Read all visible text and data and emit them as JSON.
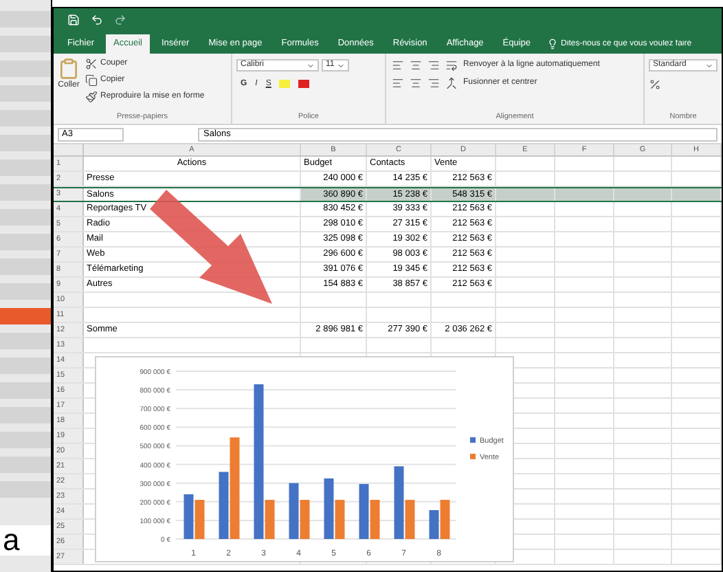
{
  "tabs": [
    {
      "label": "Fichier",
      "selected": false
    },
    {
      "label": "Accueil",
      "selected": true
    },
    {
      "label": "Insérer",
      "selected": false
    },
    {
      "label": "Mise en page",
      "selected": false
    },
    {
      "label": "Formules",
      "selected": false
    },
    {
      "label": "Données",
      "selected": false
    },
    {
      "label": "Révision",
      "selected": false
    },
    {
      "label": "Affichage",
      "selected": false
    },
    {
      "label": "Équipe",
      "selected": false
    }
  ],
  "tell_me": {
    "placeholder": "Dites-nous ce que vous voulez faire"
  },
  "ribbon": {
    "clipboard": {
      "paste": "Coller",
      "cut": "Couper",
      "copy": "Copier",
      "format_painter": "Reproduire la mise en forme",
      "label": "Presse-papiers"
    },
    "font": {
      "family": "Calibri",
      "size": "11",
      "styles": [
        "G",
        "I",
        "S"
      ],
      "label": "Police"
    },
    "alignment": {
      "wrap": "Renvoyer à la ligne automatiquement",
      "merge": "Fusionner et centrer",
      "label": "Alignement"
    },
    "number": {
      "format": "Standard",
      "label": "Nombre"
    }
  },
  "formula_bar": {
    "cell": "A3",
    "value": "Salons"
  },
  "sheet": {
    "columns": [
      "A",
      "B",
      "C",
      "D",
      "E",
      "F",
      "G",
      "H"
    ],
    "rows": [
      {
        "number": "1",
        "cells": [
          "Actions",
          "Budget",
          "Contacts",
          "Vente"
        ],
        "selected": false
      },
      {
        "number": "2",
        "cells": [
          "Presse",
          "240 000 €",
          "14 235 €",
          "212 563 €"
        ],
        "selected": false
      },
      {
        "number": "3",
        "cells": [
          "Salons",
          "360 890 €",
          "15 238 €",
          "548 315 €"
        ],
        "selected": true
      },
      {
        "number": "4",
        "cells": [
          "Reportages TV",
          "830 452 €",
          "39 333 €",
          "212 563 €"
        ],
        "selected": false
      },
      {
        "number": "5",
        "cells": [
          "Radio",
          "298 010 €",
          "27 315 €",
          "212 563 €"
        ],
        "selected": false
      },
      {
        "number": "6",
        "cells": [
          "Mail",
          "325 098 €",
          "19 302 €",
          "212 563 €"
        ],
        "selected": false
      },
      {
        "number": "7",
        "cells": [
          "Web",
          "296 600 €",
          "98 003 €",
          "212 563 €"
        ],
        "selected": false
      },
      {
        "number": "8",
        "cells": [
          "Télémarketing",
          "391 076 €",
          "19 345 €",
          "212 563 €"
        ],
        "selected": false
      },
      {
        "number": "9",
        "cells": [
          "Autres",
          "154 883 €",
          "38 857 €",
          "212 563 €"
        ],
        "selected": false
      },
      {
        "number": "10",
        "selected": false
      },
      {
        "number": "11",
        "selected": false
      },
      {
        "number": "12",
        "cells": [
          "Somme",
          "2 896 981 €",
          "277 390 €",
          "2 036 262 €"
        ],
        "selected": false
      },
      {
        "number": "13",
        "selected": false
      },
      {
        "number": "14",
        "selected": false
      },
      {
        "number": "15",
        "selected": false
      },
      {
        "number": "16",
        "selected": false
      },
      {
        "number": "17",
        "selected": false
      },
      {
        "number": "18",
        "selected": false
      },
      {
        "number": "19",
        "selected": false
      },
      {
        "number": "20",
        "selected": false
      },
      {
        "number": "21",
        "selected": false
      },
      {
        "number": "22",
        "selected": false
      },
      {
        "number": "23",
        "selected": false
      },
      {
        "number": "24",
        "selected": false
      },
      {
        "number": "25",
        "selected": false
      },
      {
        "number": "26",
        "selected": false
      },
      {
        "number": "27",
        "selected": false
      }
    ],
    "chart_data": {
      "type": "bar",
      "categories": [
        "1",
        "2",
        "3",
        "4",
        "5",
        "6",
        "7",
        "8"
      ],
      "series": [
        {
          "name": "Budget",
          "color": "#4472c4",
          "values": [
            240000,
            360000,
            830000,
            300000,
            325000,
            295000,
            390000,
            155000
          ]
        },
        {
          "name": "Vente",
          "color": "#ed7d31",
          "values": [
            210000,
            545000,
            210000,
            210000,
            210000,
            210000,
            210000,
            210000
          ]
        }
      ],
      "grid": true,
      "legend": true,
      "ylim": [
        0,
        900000
      ],
      "yticks": [
        {
          "value": 0,
          "label": "0 €"
        },
        {
          "value": 100000,
          "label": "100 000 €"
        },
        {
          "value": 200000,
          "label": "200 000 €"
        },
        {
          "value": 300000,
          "label": "300 000 €"
        },
        {
          "value": 400000,
          "label": "400 000 €"
        },
        {
          "value": 500000,
          "label": "500 000 €"
        },
        {
          "value": 600000,
          "label": "600 000 €"
        },
        {
          "value": 700000,
          "label": "700 000 €"
        },
        {
          "value": 800000,
          "label": "800 000 €"
        },
        {
          "value": 900000,
          "label": "900 000 €"
        }
      ]
    }
  },
  "page_text": "a"
}
